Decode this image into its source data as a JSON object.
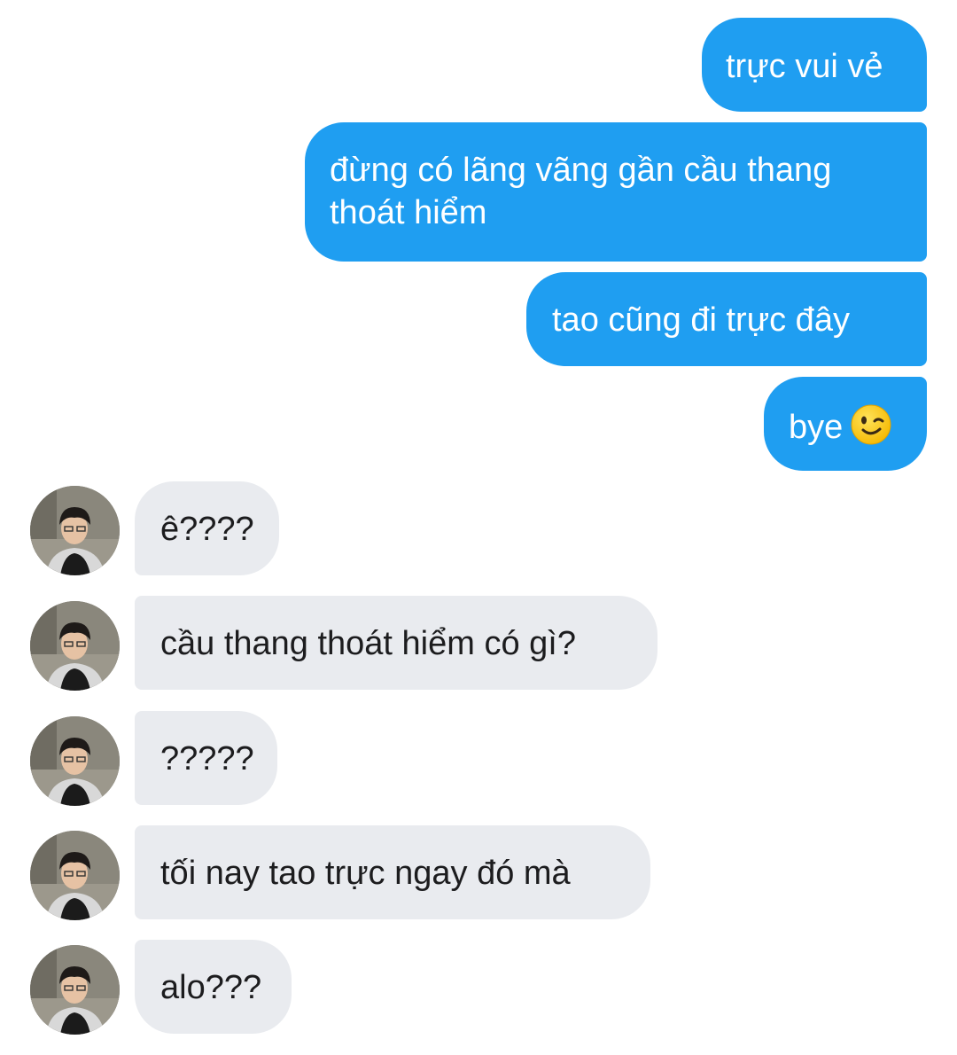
{
  "conversation": {
    "outgoing": [
      {
        "text": "trực vui vẻ"
      },
      {
        "line1": "đừng có lãng vãng gần cầu thang",
        "line2": "thoát hiểm"
      },
      {
        "text": "tao cũng đi trực đây"
      },
      {
        "text": "bye",
        "emoji": "winking-face-emoji"
      }
    ],
    "incoming": [
      {
        "text": "ê????"
      },
      {
        "text": "cầu thang thoát hiểm có gì?"
      },
      {
        "text": "?????"
      },
      {
        "text": "tối nay tao trực ngay đó mà"
      },
      {
        "text": "alo???"
      }
    ]
  },
  "colors": {
    "outgoing_bubble": "#1f9ef1",
    "incoming_bubble": "#e9ebef",
    "outgoing_text": "#ffffff",
    "incoming_text": "#1c1c1e"
  },
  "avatar_icon": "contact-profile-photo"
}
